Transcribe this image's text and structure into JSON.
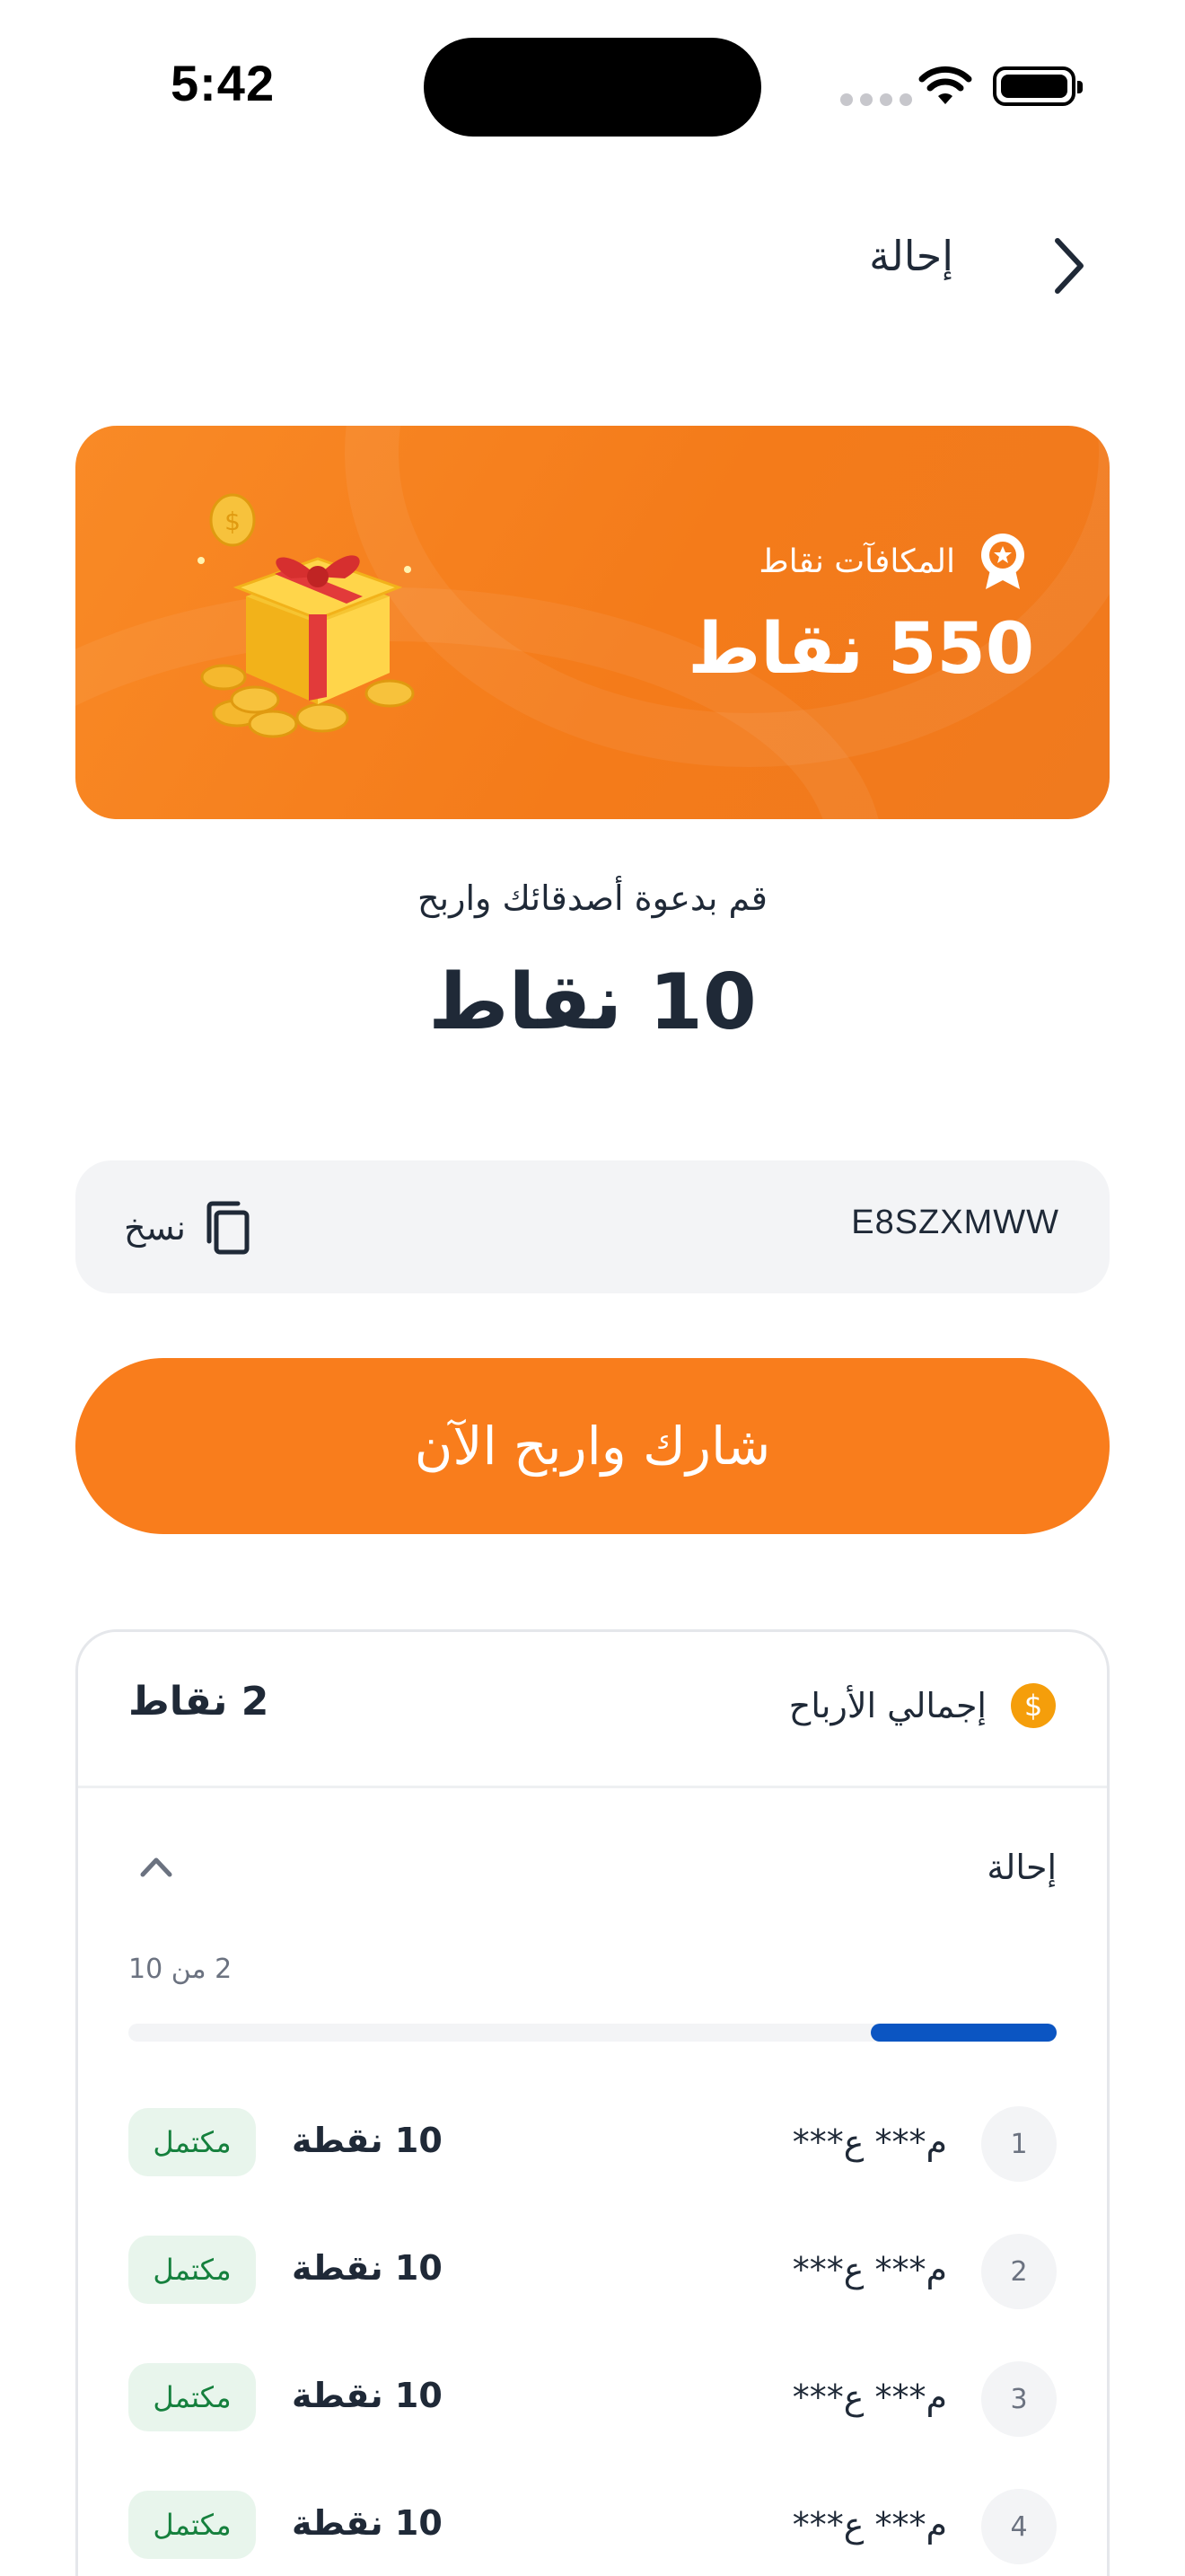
{
  "status_bar": {
    "time": "5:42"
  },
  "header": {
    "title": "إحالة",
    "back_icon": "chevron-right-icon"
  },
  "rewards_banner": {
    "label": "المكافآت نقاط",
    "points": "550 نقاط",
    "badge_icon": "award-badge-icon",
    "illustration": "gift-box-coins"
  },
  "invite": {
    "subtitle": "قم بدعوة أصدقائك واربح",
    "points": "10 نقاط"
  },
  "referral_code": {
    "code": "E8SZXMWW",
    "copy_label": "نسخ",
    "copy_icon": "copy-icon"
  },
  "share_button": {
    "label": "شارك واربح الآن"
  },
  "earnings": {
    "label": "إجمالي الأرباح",
    "total": "2 نقاط",
    "coin_icon": "dollar-coin-icon",
    "coin_color": "#f59e0b"
  },
  "referral_section": {
    "title": "إحالة",
    "progress_text": "2 من 10",
    "progress_value": 0.2,
    "progress_color": "#0b55c2",
    "rows": [
      {
        "index": "1",
        "name": "م*** ع***",
        "points": "10 نقطة",
        "status": "مكتمل"
      },
      {
        "index": "2",
        "name": "م*** ع***",
        "points": "10 نقطة",
        "status": "مكتمل"
      },
      {
        "index": "3",
        "name": "م*** ع***",
        "points": "10 نقطة",
        "status": "مكتمل"
      },
      {
        "index": "4",
        "name": "م*** ع***",
        "points": "10 نقطة",
        "status": "مكتمل"
      }
    ]
  },
  "colors": {
    "accent": "#f97d1c",
    "status_complete_bg": "#e8f5ec",
    "status_complete_text": "#15803d"
  }
}
